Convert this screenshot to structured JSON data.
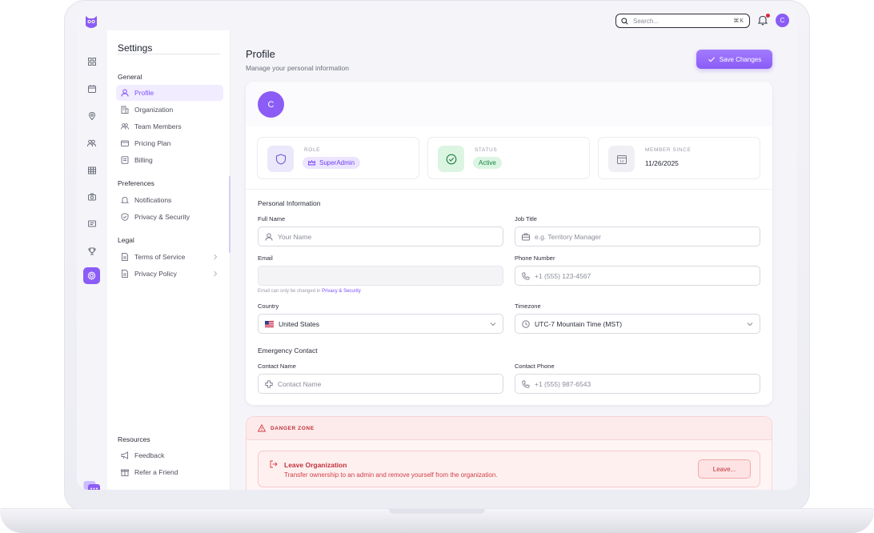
{
  "topbar": {
    "search_placeholder": "Search...",
    "search_shortcut": "⌘K",
    "avatar_initial": "C"
  },
  "settings": {
    "title": "Settings",
    "groups": {
      "general": "General",
      "preferences": "Preferences",
      "legal": "Legal",
      "resources": "Resources"
    },
    "items": {
      "profile": "Profile",
      "organization": "Organization",
      "team_members": "Team Members",
      "pricing_plan": "Pricing Plan",
      "billing": "Billing",
      "notifications": "Notifications",
      "privacy_security": "Privacy & Security",
      "terms_of_service": "Terms of Service",
      "privacy_policy": "Privacy Policy",
      "feedback": "Feedback",
      "refer_friend": "Refer a Friend"
    }
  },
  "page": {
    "title": "Profile",
    "subtitle": "Manage your personal information",
    "save_label": "Save Changes"
  },
  "profile": {
    "avatar_initial": "C",
    "role_label": "ROLE",
    "role_value": "SuperAdmin",
    "status_label": "STATUS",
    "status_value": "Active",
    "member_since_label": "MEMBER SINCE",
    "member_since_value": "11/26/2025"
  },
  "form": {
    "personal_title": "Personal Information",
    "full_name_label": "Full Name",
    "full_name_placeholder": "Your Name",
    "job_title_label": "Job Title",
    "job_title_placeholder": "e.g. Territory Manager",
    "email_label": "Email",
    "email_value": "",
    "email_helper_prefix": "Email can only be changed in",
    "email_helper_link": "Privacy & Security",
    "phone_label": "Phone Number",
    "phone_placeholder": "+1 (555) 123-4567",
    "country_label": "Country",
    "country_value": "United States",
    "timezone_label": "Timezone",
    "timezone_value": "UTC-7 Mountain Time (MST)",
    "emergency_title": "Emergency Contact",
    "contact_name_label": "Contact Name",
    "contact_name_placeholder": "Contact Name",
    "contact_phone_label": "Contact Phone",
    "contact_phone_placeholder": "+1 (555) 987-6543"
  },
  "danger": {
    "title": "DANGER ZONE",
    "leave_title": "Leave Organization",
    "leave_desc": "Transfer ownership to an admin and remove yourself from the organization.",
    "leave_button": "Leave..."
  },
  "colors": {
    "accent": "#8b5cf6",
    "danger": "#c0323a",
    "success": "#16a34a"
  },
  "icons": {
    "rail": [
      "grid-icon",
      "calendar-icon",
      "map-pin-icon",
      "users-icon",
      "table-icon",
      "camera-icon",
      "message-icon",
      "trophy-icon",
      "settings-icon"
    ]
  }
}
